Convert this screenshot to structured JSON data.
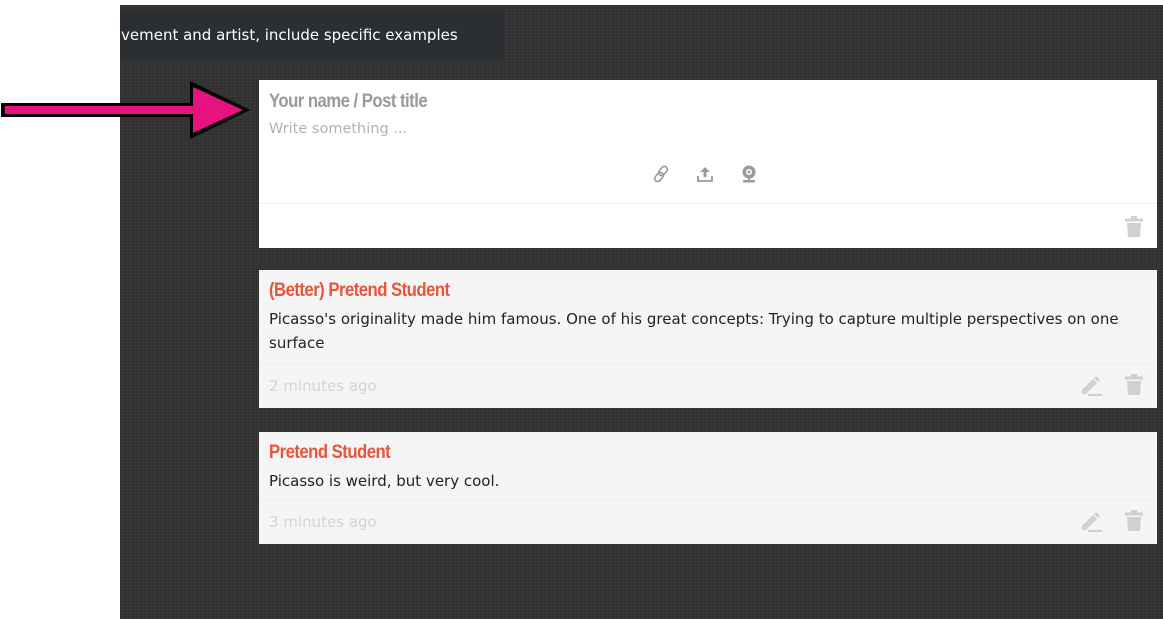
{
  "topic": {
    "text": "vement and artist, include specific examples"
  },
  "compose": {
    "title_placeholder": "Your name / Post title",
    "body_placeholder": "Write something ...",
    "attachments": [
      {
        "icon": "link-icon"
      },
      {
        "icon": "upload-icon"
      },
      {
        "icon": "webcam-icon"
      }
    ],
    "trash_icon": "trash-icon"
  },
  "posts": [
    {
      "title": "(Better) Pretend Student",
      "body": "Picasso's originality made him famous. One of his great concepts: Trying to capture multiple perspectives on one surface",
      "time": "2 minutes ago"
    },
    {
      "title": "Pretend Student",
      "body": "Picasso is weird, but very cool.",
      "time": "3 minutes ago"
    }
  ],
  "colors": {
    "background": "#333333",
    "post_title": "#e8553a",
    "arrow": "#e6127f",
    "topic_bar": "#2b2f33"
  }
}
